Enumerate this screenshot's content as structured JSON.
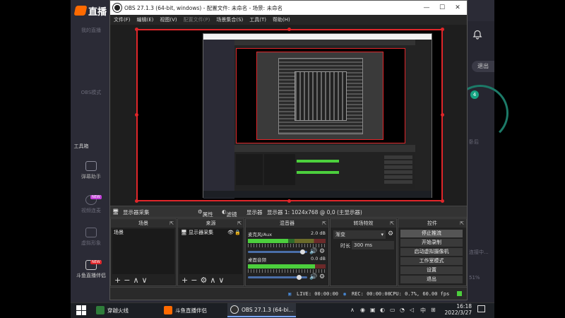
{
  "bg_app": {
    "logo_text": "直播",
    "side_items": [
      "我的直播",
      "OBS模式",
      "工具箱",
      "弹幕助手",
      "视频连麦",
      "虚拟形象",
      "斗鱼直播伴侣"
    ],
    "new_badge": "NEW",
    "exit_label": "退出",
    "right_label_1": "连接中...",
    "right_label_2": "51%",
    "right_label_3": "卧后",
    "ring_value": "4"
  },
  "obs": {
    "title": "OBS 27.1.3 (64-bit, windows) - 配置文件: 未命名 - 场景: 未命名",
    "menu": [
      "文件(F)",
      "编辑(E)",
      "视图(V)",
      "配置文件(P)",
      "场景集合(S)",
      "工具(T)",
      "帮助(H)"
    ],
    "window_controls": {
      "min": "—",
      "max": "☐",
      "close": "✕"
    },
    "source_bar": {
      "source_name": "显示器采集",
      "properties": "属性",
      "filters": "滤镜",
      "display_label": "显示器",
      "display_value": "显示器 1: 1024x768 @ 0,0 (主显示器)"
    },
    "docks": {
      "scenes": {
        "title": "场景",
        "items": [
          "场景"
        ]
      },
      "sources": {
        "title": "来源",
        "items": [
          "显示器采集"
        ]
      },
      "mixer": {
        "title": "混音器",
        "channels": [
          {
            "name": "麦克风/Aux",
            "db": "2.0 dB",
            "level": 0.52,
            "volume": 0.92
          },
          {
            "name": "桌面音频",
            "db": "0.0 dB",
            "level": 0.86,
            "volume": 0.86
          }
        ]
      },
      "transitions": {
        "title": "转场特效",
        "type": "渐变",
        "duration_label": "时长",
        "duration_value": "300 ms"
      },
      "controls": {
        "title": "控件",
        "buttons": [
          "停止推流",
          "开始录制",
          "启动虚拟摄像机",
          "工作室模式",
          "设置",
          "退出"
        ]
      }
    },
    "status": {
      "live": "LIVE: 00:00:00",
      "rec": "REC: 00:00:00",
      "cpu": "CPU: 0.7%, 60.00 fps"
    }
  },
  "taskbar": {
    "items": [
      {
        "label": "穿越火线",
        "color": "#2f7d3a"
      },
      {
        "label": "斗鱼直播伴侣",
        "color": "#ff6a00"
      },
      {
        "label": "OBS 27.1.3 (64-bi...",
        "color": "#303030"
      }
    ],
    "tray_lang": "中",
    "time": "16:18",
    "date": "2022/3/27"
  },
  "colors": {
    "preview_border": "#e0262a",
    "accent_blue": "#4a6ea8",
    "meter_green": "#4ccf3d"
  }
}
